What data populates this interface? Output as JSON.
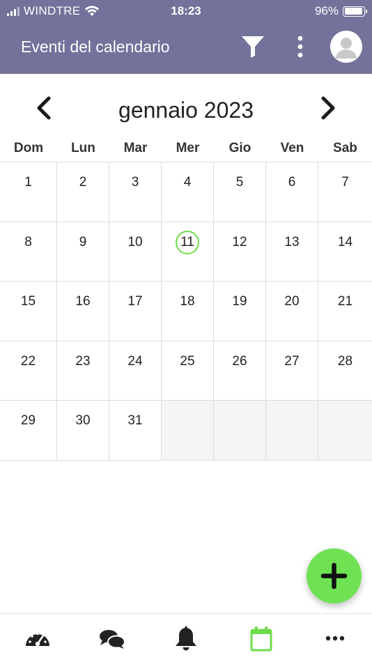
{
  "status_bar": {
    "carrier": "WINDTRE",
    "time": "18:23",
    "battery": "96%",
    "battery_level": 0.96
  },
  "app_bar": {
    "title": "Eventi del calendario",
    "icons": [
      "filter-icon",
      "more-vert-icon",
      "avatar-icon"
    ]
  },
  "calendar": {
    "month_label": "gennaio 2023",
    "prev_icon": "chevron-left-icon",
    "next_icon": "chevron-right-icon",
    "weekdays": [
      "Dom",
      "Lun",
      "Mar",
      "Mer",
      "Gio",
      "Ven",
      "Sab"
    ],
    "weeks": [
      [
        "1",
        "2",
        "3",
        "4",
        "5",
        "6",
        "7"
      ],
      [
        "8",
        "9",
        "10",
        "11",
        "12",
        "13",
        "14"
      ],
      [
        "15",
        "16",
        "17",
        "18",
        "19",
        "20",
        "21"
      ],
      [
        "22",
        "23",
        "24",
        "25",
        "26",
        "27",
        "28"
      ],
      [
        "29",
        "30",
        "31",
        "",
        "",
        "",
        ""
      ]
    ],
    "today": "11",
    "today_color": "#6ddc4a"
  },
  "fab": {
    "icon": "plus-icon",
    "color": "#6fe254"
  },
  "bottom_nav": {
    "items": [
      {
        "icon": "dashboard-gauge-icon",
        "active": false
      },
      {
        "icon": "chat-bubbles-icon",
        "active": false
      },
      {
        "icon": "bell-icon",
        "active": false
      },
      {
        "icon": "calendar-icon",
        "active": true
      },
      {
        "icon": "more-horiz-icon",
        "active": false
      }
    ],
    "active_color": "#6ddc4a"
  },
  "colors": {
    "app_bar": "#72729a",
    "grid_line": "#dcdcdc",
    "empty_cell": "#f4f6f5"
  }
}
